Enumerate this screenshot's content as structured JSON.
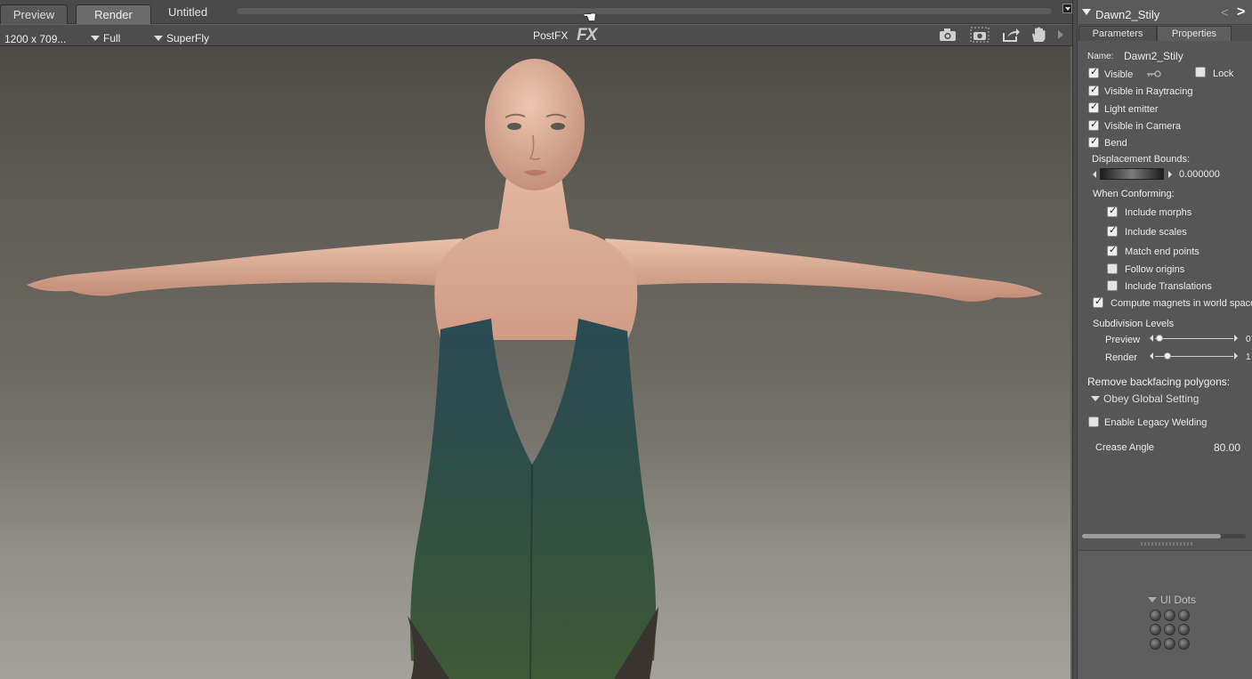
{
  "tabs": {
    "preview": "Preview",
    "render": "Render",
    "document_title": "Untitled"
  },
  "render_options": {
    "resolution": "1200 x 709...",
    "dimension_mode": "Full",
    "engine": "SuperFly",
    "postfx_label": "PostFX",
    "fx_icon_text": "FX"
  },
  "toolbar_icons": [
    "camera-icon",
    "camera-snapshot-icon",
    "share-export-icon",
    "hand-pan-icon",
    "expand-arrow-icon"
  ],
  "panel": {
    "title": "Dawn2_Stily",
    "nav_prev": "<",
    "nav_next": ">",
    "tabs": {
      "parameters": "Parameters",
      "properties": "Properties"
    },
    "name_label": "Name:",
    "name_value": "Dawn2_Stily",
    "checks": {
      "visible": {
        "label": "Visible",
        "checked": true
      },
      "lock": {
        "label": "Lock",
        "checked": false
      },
      "visible_raytracing": {
        "label": "Visible in Raytracing",
        "checked": true
      },
      "light_emitter": {
        "label": "Light emitter",
        "checked": true
      },
      "visible_camera": {
        "label": "Visible in Camera",
        "checked": true
      },
      "bend": {
        "label": "Bend",
        "checked": true
      }
    },
    "displacement_label": "Displacement Bounds:",
    "displacement_value": "0.000000",
    "conforming_label": "When Conforming:",
    "conforming": {
      "include_morphs": {
        "label": "Include morphs",
        "checked": true
      },
      "include_scales": {
        "label": "Include scales",
        "checked": true
      },
      "match_end_points": {
        "label": "Match end points",
        "checked": true
      },
      "follow_origins": {
        "label": "Follow origins",
        "checked": false
      },
      "include_translations": {
        "label": "Include Translations",
        "checked": false
      }
    },
    "compute_magnets": {
      "label": "Compute magnets in world space",
      "checked": true
    },
    "subdivision_label": "Subdivision Levels",
    "subdivision": {
      "preview_label": "Preview",
      "preview_value": "0",
      "render_label": "Render",
      "render_value": "1"
    },
    "backfacing_label": "Remove backfacing polygons:",
    "backfacing_option": "Obey Global Setting",
    "legacy_welding": {
      "label": "Enable Legacy Welding",
      "checked": false
    },
    "crease_label": "Crease Angle",
    "crease_value": "80.00",
    "ui_dots_label": "UI Dots"
  }
}
